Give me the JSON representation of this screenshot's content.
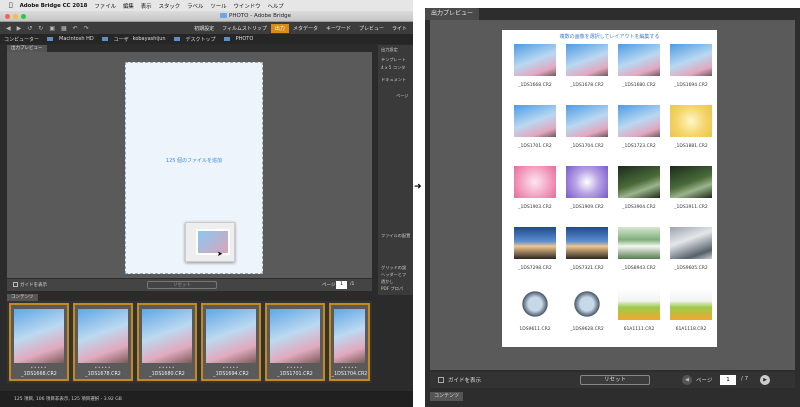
{
  "menubar": {
    "app": "Adobe Bridge CC 2018",
    "items": [
      "ファイル",
      "編集",
      "表示",
      "スタック",
      "ラベル",
      "ツール",
      "ウインドウ",
      "ヘルプ"
    ]
  },
  "window": {
    "title": "PHOTO - Adobe Bridge"
  },
  "toolbar": {
    "workspaces": [
      "初期設定",
      "フィルムストリップ",
      "出力",
      "メタデータ",
      "キーワード",
      "プレビュー",
      "ライト"
    ],
    "active_workspace": "出力"
  },
  "path": {
    "items": [
      "コンピューター",
      "Macintosh HD",
      "ユーザ",
      "kobayashijun",
      "デスクトップ",
      "PHOTO"
    ]
  },
  "left_output": {
    "tab": "出力プレビュー",
    "drop_message": "125 個のファイルを追加",
    "guide_label": "ガイドを表示",
    "reset_label": "リセット",
    "page_label": "ページ",
    "page_value": "1",
    "page_total": "/1",
    "right_panel": [
      "出力設定",
      "テンプレート",
      "4 x 5 コンタ",
      "ドキュメント",
      "ページ",
      "ファイルの配置",
      "グリッドの設",
      "ヘッダーとフ",
      "透かし",
      "PDF プロパ"
    ]
  },
  "filmstrip": {
    "tab": "コンテンツ",
    "items": [
      "_1DS1668.CR2",
      "_1DS1678.CR2",
      "_1DS1680.CR2",
      "_1DS1694.CR2",
      "_1DS1701.CR2",
      "_1DS1704.CR2"
    ]
  },
  "statusbar": {
    "text": "125 項目, 106 項目非表示, 125 項目選択 - 3.92 GB"
  },
  "right_output": {
    "tab": "出力プレビュー",
    "title": "複数の画像を選択してレイアウトを編集する",
    "photos": [
      {
        "name": "_1DS1668.CR2",
        "color": "sky"
      },
      {
        "name": "_1DS1678.CR2",
        "color": "sky"
      },
      {
        "name": "_1DS1680.CR2",
        "color": "sky"
      },
      {
        "name": "_1DS1694.CR2",
        "color": "sky"
      },
      {
        "name": "_1DS1701.CR2",
        "color": "sky"
      },
      {
        "name": "_1DS1704.CR2",
        "color": "sky"
      },
      {
        "name": "_1DS1723.CR2",
        "color": "sky"
      },
      {
        "name": "_1DS1881.CR2",
        "color": "rose"
      },
      {
        "name": "_1DS1903.CR2",
        "color": "pink"
      },
      {
        "name": "_1DS1909.CR2",
        "color": "violet"
      },
      {
        "name": "_1DS3904.CR2",
        "color": "forest"
      },
      {
        "name": "_1DS3911.CR2",
        "color": "forest"
      },
      {
        "name": "_1DS7298.CR2",
        "color": "dusk"
      },
      {
        "name": "_1DS7321.CR2",
        "color": "dusk"
      },
      {
        "name": "_1DS8943.CR2",
        "color": "falls"
      },
      {
        "name": "_1DS9605.CR2",
        "color": "gray"
      },
      {
        "name": "1DS9611.CR2",
        "color": "fisheye"
      },
      {
        "name": "_1DS9628.CR2",
        "color": "fisheye"
      },
      {
        "name": "61A1111.CR2",
        "color": "drink"
      },
      {
        "name": "61A1118.CR2",
        "color": "drink"
      }
    ],
    "guide_label": "ガイドを表示",
    "reset_label": "リセット",
    "page_label": "ページ",
    "page_value": "1",
    "page_total": "/ 7",
    "filmstrip_tab": "コンテンツ"
  }
}
